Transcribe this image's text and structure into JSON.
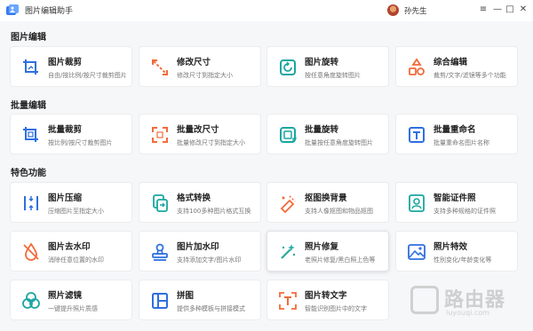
{
  "app": {
    "title": "图片编辑助手",
    "user_name": "孙先生"
  },
  "window_controls": {
    "menu": "≡",
    "minimize": "—",
    "maximize": "□",
    "close": "✕"
  },
  "sections": {
    "edit": {
      "title": "图片编辑",
      "cards": [
        {
          "title": "图片裁剪",
          "desc": "自由/按比例/按尺寸裁剪图片",
          "icon": "crop-icon"
        },
        {
          "title": "修改尺寸",
          "desc": "修改尺寸到指定大小",
          "icon": "resize-arrows-icon"
        },
        {
          "title": "图片旋转",
          "desc": "按任意角度旋转图片",
          "icon": "rotate-icon"
        },
        {
          "title": "综合编辑",
          "desc": "裁剪/文字/滤镜等多个功能",
          "icon": "shapes-icon"
        }
      ]
    },
    "batch": {
      "title": "批量编辑",
      "cards": [
        {
          "title": "批量裁剪",
          "desc": "按比例/按尺寸裁剪图片",
          "icon": "crop-icon"
        },
        {
          "title": "批量改尺寸",
          "desc": "批量修改尺寸到指定大小",
          "icon": "resize-arrows-icon"
        },
        {
          "title": "批量旋转",
          "desc": "批量按任意角度旋转图片",
          "icon": "rotate-icon"
        },
        {
          "title": "批量重命名",
          "desc": "批量重命名图片名称",
          "icon": "text-t-icon"
        }
      ]
    },
    "special": {
      "title": "特色功能",
      "cards": [
        {
          "title": "图片压缩",
          "desc": "压缩图片至指定大小",
          "icon": "compress-icon"
        },
        {
          "title": "格式转换",
          "desc": "支持100多种图片格式互换",
          "icon": "convert-icon"
        },
        {
          "title": "抠图换背景",
          "desc": "支持人像抠图和物品抠图",
          "icon": "eraser-icon"
        },
        {
          "title": "智能证件照",
          "desc": "支持多种规格的证件照",
          "icon": "id-photo-icon"
        },
        {
          "title": "图片去水印",
          "desc": "消除任意位置的水印",
          "icon": "drop-remove-icon"
        },
        {
          "title": "图片加水印",
          "desc": "支持添加文字/图片水印",
          "icon": "stamp-icon"
        },
        {
          "title": "照片修复",
          "desc": "老照片修复/黑白照上色等",
          "icon": "magic-wand-icon"
        },
        {
          "title": "照片特效",
          "desc": "性别变化/年龄变化等",
          "icon": "landscape-icon"
        },
        {
          "title": "照片滤镜",
          "desc": "一键提升照片质感",
          "icon": "filter-circles-icon"
        },
        {
          "title": "拼图",
          "desc": "提供多种模板与拼接模式",
          "icon": "collage-icon"
        },
        {
          "title": "图片转文字",
          "desc": "智能识别图片中的文字",
          "icon": "ocr-icon"
        }
      ]
    }
  },
  "watermark": {
    "text": "路由器",
    "url": "luyouqi.com"
  },
  "colors": {
    "blue": "#2f6fe0",
    "orange": "#f26b3a",
    "teal": "#1aa6a0",
    "accent_teal": "#2aa8a2"
  }
}
